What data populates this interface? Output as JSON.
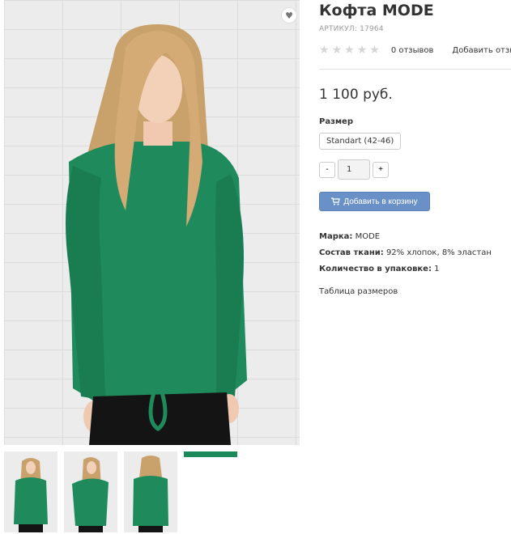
{
  "product": {
    "title": "Кофта MODE",
    "sku": "АРТИКУЛ: 17964",
    "reviews_count": "0 отзывов",
    "add_review": "Добавить отзы",
    "rating": 0,
    "rating_max": 5,
    "price": "1 100 руб."
  },
  "size": {
    "label": "Размер",
    "selected": "Standart (42-46)"
  },
  "quantity": {
    "minus": "-",
    "value": "1",
    "plus": "+"
  },
  "cart": {
    "label": "Добавить в корзину",
    "icon": "cart-icon"
  },
  "attributes": [
    {
      "label": "Марка:",
      "value": "MODE"
    },
    {
      "label": "Состав ткани:",
      "value": "92% хлопок, 8% эластан"
    },
    {
      "label": "Количество в упаковке:",
      "value": "1"
    }
  ],
  "size_table": "Таблица размеров",
  "colors": {
    "garment": "#1b8a5a",
    "button": "#6a91c7"
  }
}
